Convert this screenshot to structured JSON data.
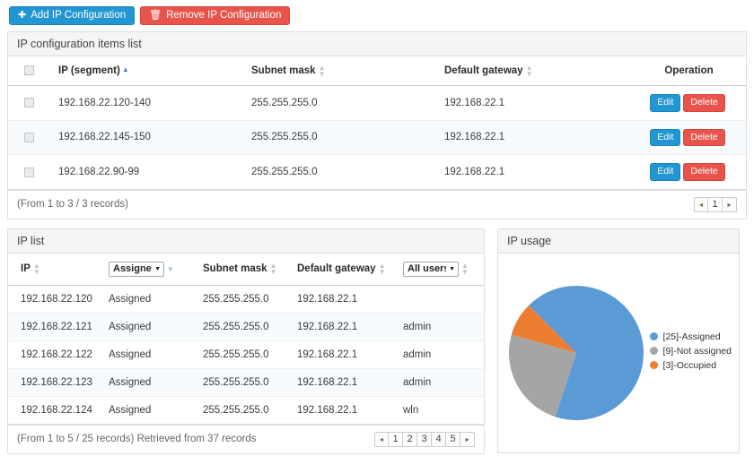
{
  "toolbar": {
    "add_label": "Add IP Configuration",
    "add_icon": "plus-icon",
    "remove_label": "Remove IP Configuration",
    "remove_icon": "trash-icon",
    "add_color": "#2196d3",
    "remove_color": "#e8544c"
  },
  "config_panel": {
    "title": "IP configuration items list",
    "columns": [
      "",
      "IP (segment)",
      "Subnet mask",
      "Default gateway",
      "Operation"
    ],
    "rows": [
      {
        "ip": "192.168.22.120-140",
        "mask": "255.255.255.0",
        "gateway": "192.168.22.1",
        "edit": "Edit",
        "delete": "Delete"
      },
      {
        "ip": "192.168.22.145-150",
        "mask": "255.255.255.0",
        "gateway": "192.168.22.1",
        "edit": "Edit",
        "delete": "Delete"
      },
      {
        "ip": "192.168.22.90-99",
        "mask": "255.255.255.0",
        "gateway": "192.168.22.1",
        "edit": "Edit",
        "delete": "Delete"
      }
    ],
    "footer_text": "(From 1 to 3 / 3 records)",
    "pager": {
      "prev": "◂",
      "pages": [
        "1"
      ],
      "next": "▸"
    }
  },
  "ip_list_panel": {
    "title": "IP list",
    "columns": {
      "ip": "IP",
      "status_select": "Assigned",
      "mask": "Subnet mask",
      "gateway": "Default gateway",
      "user_select": "All users"
    },
    "rows": [
      {
        "ip": "192.168.22.120",
        "status": "Assigned",
        "mask": "255.255.255.0",
        "gateway": "192.168.22.1",
        "user": ""
      },
      {
        "ip": "192.168.22.121",
        "status": "Assigned",
        "mask": "255.255.255.0",
        "gateway": "192.168.22.1",
        "user": "admin"
      },
      {
        "ip": "192.168.22.122",
        "status": "Assigned",
        "mask": "255.255.255.0",
        "gateway": "192.168.22.1",
        "user": "admin"
      },
      {
        "ip": "192.168.22.123",
        "status": "Assigned",
        "mask": "255.255.255.0",
        "gateway": "192.168.22.1",
        "user": "admin"
      },
      {
        "ip": "192.168.22.124",
        "status": "Assigned",
        "mask": "255.255.255.0",
        "gateway": "192.168.22.1",
        "user": "wln"
      }
    ],
    "footer_text": "(From 1 to 5 / 25 records) Retrieved from 37 records",
    "pager": {
      "prev": "◂",
      "pages": [
        "1",
        "2",
        "3",
        "4",
        "5"
      ],
      "next": "▸"
    }
  },
  "usage_panel": {
    "title": "IP usage"
  },
  "chart_data": {
    "type": "pie",
    "title": "IP usage",
    "labels": [
      "[25]-Assigned",
      "[9]-Not assigned",
      "[3]-Occupied"
    ],
    "values": [
      25,
      9,
      3
    ],
    "colors": [
      "#5b9bd5",
      "#a5a5a5",
      "#ed7d31"
    ],
    "legend_position": "right",
    "total": 37
  }
}
